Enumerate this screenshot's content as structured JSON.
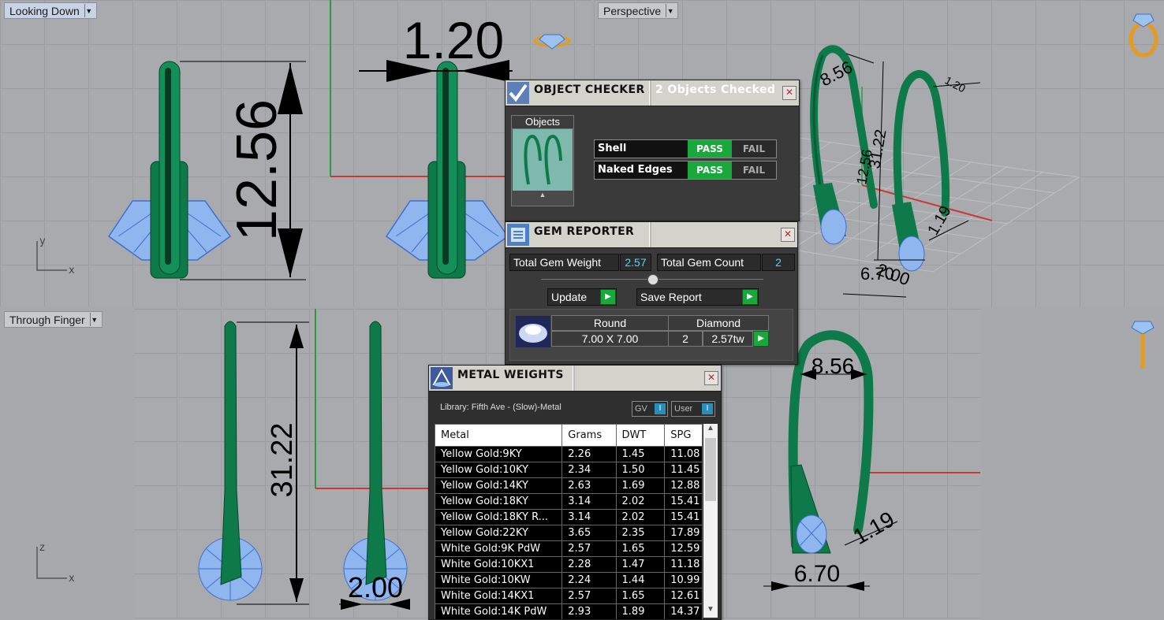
{
  "viewports": {
    "top_left": {
      "label": "Looking Down",
      "dims": [
        "1.20",
        "12.56"
      ],
      "axes": [
        "y",
        "x"
      ]
    },
    "top_right": {
      "label": "Perspective",
      "dims": [
        "8.56",
        "1.20",
        "31.22",
        "12.56",
        "1.19",
        "6.70",
        "2.00"
      ]
    },
    "bottom_left": {
      "label": "Through Finger",
      "dims": [
        "31.22",
        "2.00"
      ],
      "axes": [
        "z",
        "x"
      ]
    },
    "bottom_right": {
      "dims": [
        "8.56",
        "1.19",
        "6.70"
      ]
    }
  },
  "object_checker": {
    "title": "OBJECT CHECKER",
    "status": "2  Objects Checked",
    "objects_label": "Objects",
    "checks": [
      {
        "name": "Shell",
        "pass": "PASS",
        "fail": "FAIL"
      },
      {
        "name": "Naked Edges",
        "pass": "PASS",
        "fail": "FAIL"
      }
    ]
  },
  "gem_reporter": {
    "title": "GEM REPORTER",
    "total_weight_label": "Total Gem Weight",
    "total_weight": "2.57",
    "total_count_label": "Total Gem Count",
    "total_count": "2",
    "update_label": "Update",
    "save_label": "Save Report",
    "gem": {
      "shape": "Round",
      "type": "Diamond",
      "size": "7.00 X 7.00",
      "count": "2",
      "weight": "2.57tw"
    }
  },
  "metal_weights": {
    "title": "METAL WEIGHTS",
    "library": "Library: Fifth Ave - (Slow)-Metal",
    "toggle_gv": "GV",
    "toggle_user": "User",
    "columns": [
      "Metal",
      "Grams",
      "DWT",
      "SPG"
    ],
    "rows": [
      [
        "Yellow Gold:9KY",
        "2.26",
        "1.45",
        "11.08"
      ],
      [
        "Yellow Gold:10KY",
        "2.34",
        "1.50",
        "11.45"
      ],
      [
        "Yellow Gold:14KY",
        "2.63",
        "1.69",
        "12.88"
      ],
      [
        "Yellow Gold:18KY",
        "3.14",
        "2.02",
        "15.41"
      ],
      [
        "Yellow Gold:18KY R...",
        "3.14",
        "2.02",
        "15.41"
      ],
      [
        "Yellow Gold:22KY",
        "3.65",
        "2.35",
        "17.89"
      ],
      [
        "White Gold:9K PdW",
        "2.57",
        "1.65",
        "12.59"
      ],
      [
        "White Gold:10KX1",
        "2.28",
        "1.47",
        "11.18"
      ],
      [
        "White Gold:10KW",
        "2.24",
        "1.44",
        "10.99"
      ],
      [
        "White Gold:14KX1",
        "2.57",
        "1.65",
        "12.61"
      ],
      [
        "White Gold:14K PdW",
        "2.93",
        "1.89",
        "14.37"
      ]
    ]
  },
  "colors": {
    "metal": "#0e7a4a",
    "gem": "#8fb6ee",
    "pass": "#18a83c",
    "axis_x": "#c83a36",
    "axis_y": "#2e9a3e"
  }
}
